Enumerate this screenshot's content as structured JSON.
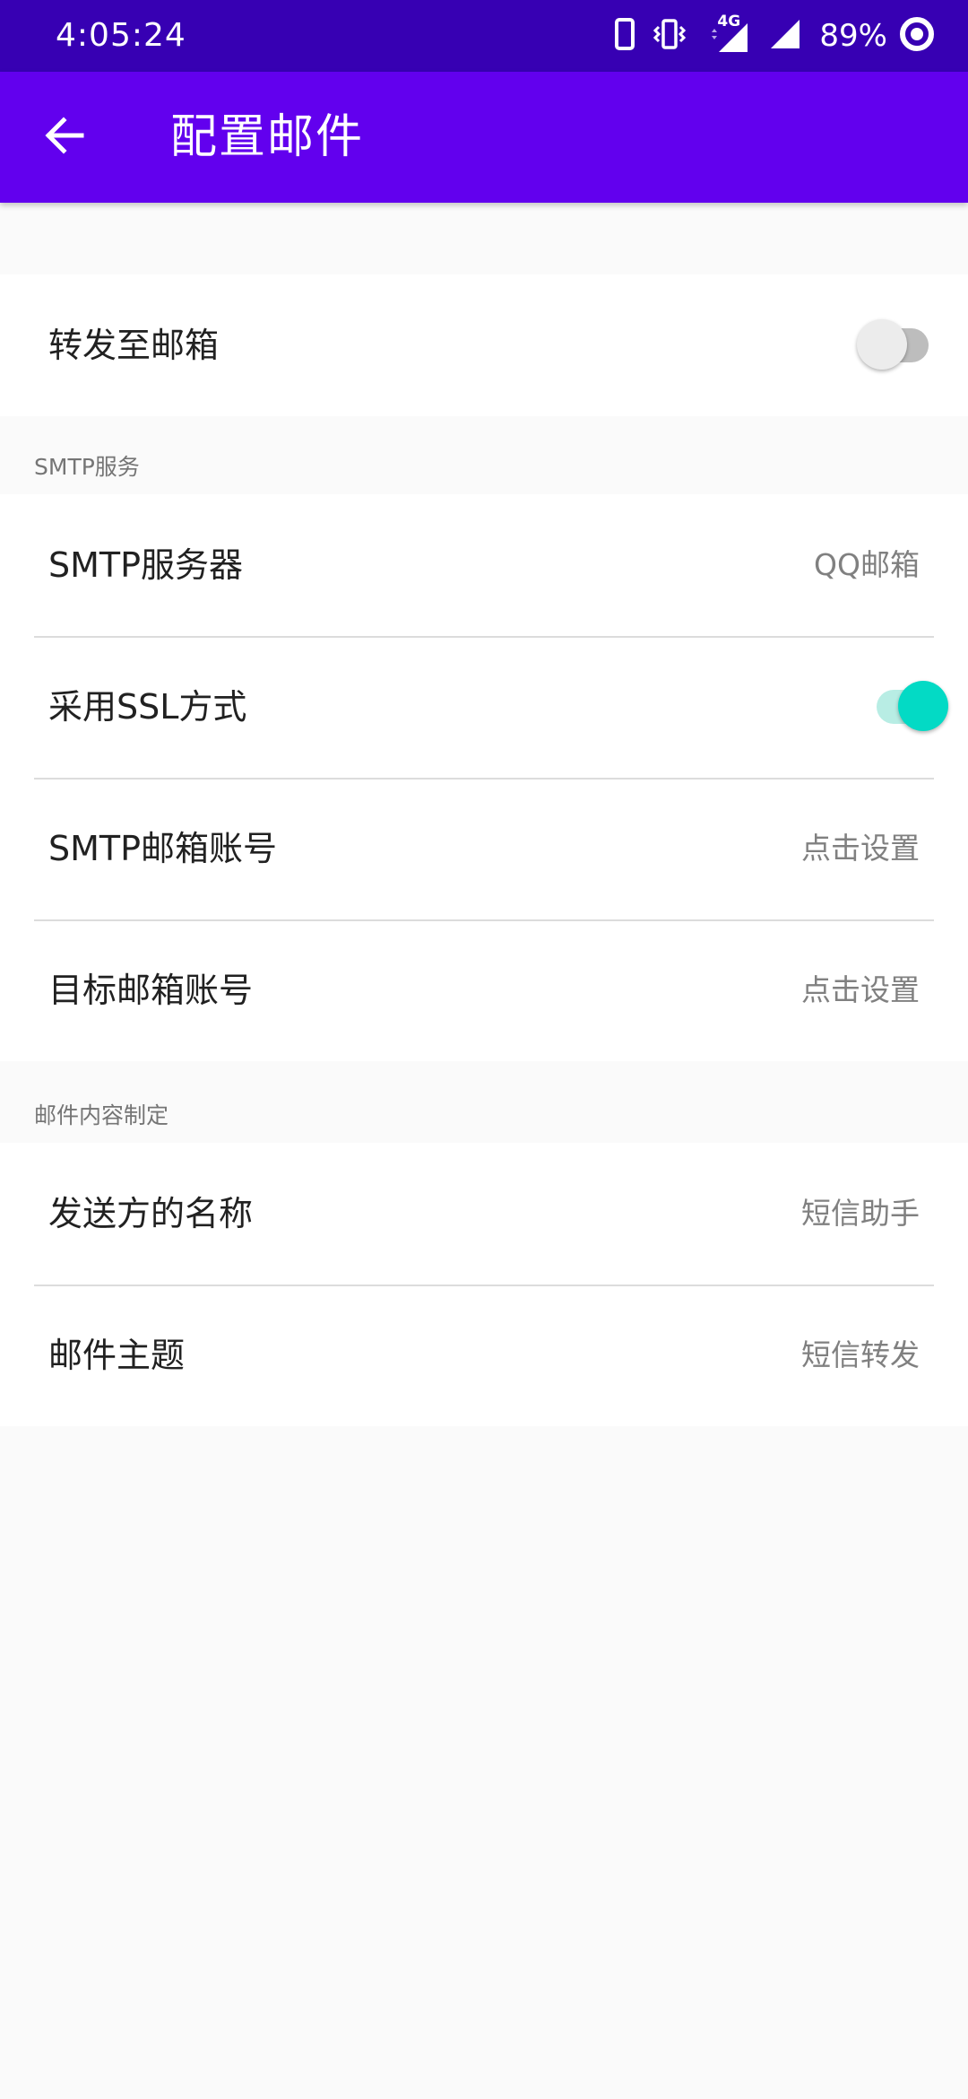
{
  "status_bar": {
    "time": "4:05:24",
    "battery": "89%",
    "network": "4G",
    "icons": [
      "phone-icon",
      "vibrate-icon",
      "signal-4g-icon",
      "signal-icon",
      "battery-ring-icon"
    ]
  },
  "app_bar": {
    "title": "配置邮件",
    "back_icon": "arrow-back-icon",
    "color": "#6200ee"
  },
  "forward_group": {
    "label": "转发至邮箱",
    "enabled": false
  },
  "smtp_section": {
    "header": "SMTP服务",
    "server_label": "SMTP服务器",
    "server_value": "QQ邮箱",
    "ssl_label": "采用SSL方式",
    "ssl_enabled": true,
    "account_label": "SMTP邮箱账号",
    "account_value": "点击设置",
    "target_label": "目标邮箱账号",
    "target_value": "点击设置"
  },
  "content_section": {
    "header": "邮件内容制定",
    "sender_label": "发送方的名称",
    "sender_value": "短信助手",
    "subject_label": "邮件主题",
    "subject_value": "短信转发"
  },
  "colors": {
    "status_bar": "#3700b3",
    "primary": "#6200ee",
    "switch_accent": "#03dac5",
    "background": "#fafafa"
  }
}
